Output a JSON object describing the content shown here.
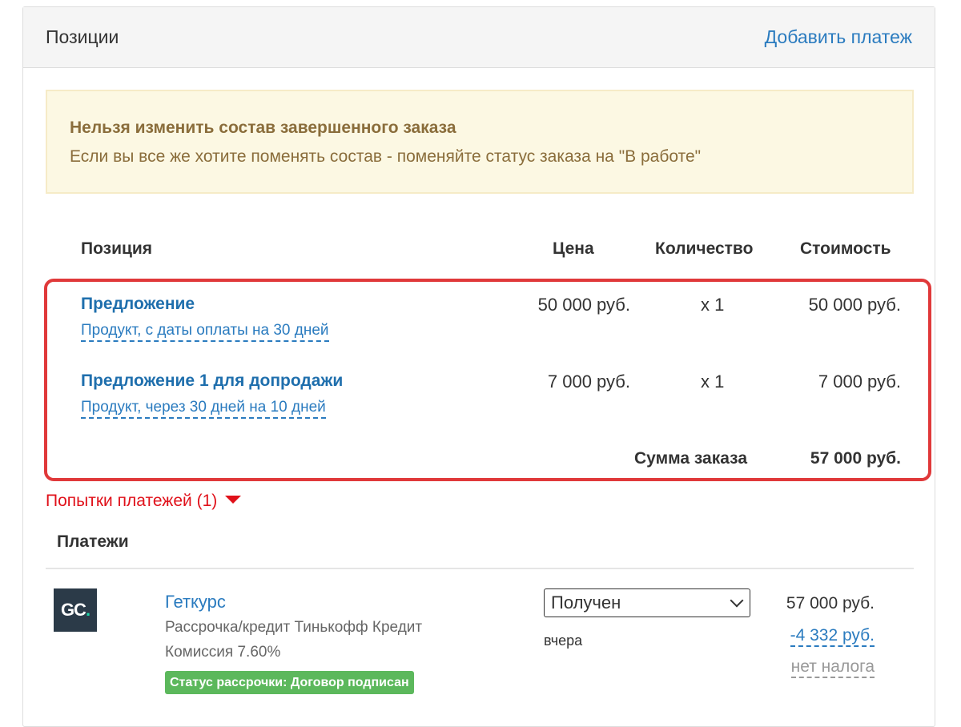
{
  "panel": {
    "title": "Позиции",
    "add_payment_label": "Добавить платеж"
  },
  "alert": {
    "title": "Нельзя изменить состав завершенного заказа",
    "text": "Если вы все же хотите поменять состав - поменяйте статус заказа на \"В работе\""
  },
  "table": {
    "headers": {
      "position": "Позиция",
      "price": "Цена",
      "quantity": "Количество",
      "cost": "Стоимость"
    },
    "rows": [
      {
        "name": "Предложение",
        "subtitle": "Продукт, с даты оплаты на 30 дней",
        "price": "50 000 руб.",
        "quantity": "x 1",
        "cost": "50 000 руб."
      },
      {
        "name": "Предложение 1 для допродажи",
        "subtitle": "Продукт, через 30 дней на 10 дней",
        "price": "7 000 руб.",
        "quantity": "x 1",
        "cost": "7 000 руб."
      }
    ],
    "total_label": "Сумма заказа",
    "total_value": "57 000 руб."
  },
  "attempts": {
    "label": "Попытки платежей (1)"
  },
  "payments": {
    "title": "Платежи",
    "items": [
      {
        "logo_text": "GC",
        "logo_dot": ".",
        "name": "Геткурс",
        "method": "Рассрочка/кредит Тинькофф Кредит",
        "commission": "Комиссия 7.60%",
        "badge": "Статус рассрочки: Договор подписан",
        "status": "Получен",
        "date": "вчера",
        "amount": "57 000 руб.",
        "fee": "-4 332 руб.",
        "tax": "нет налога"
      }
    ]
  },
  "colors": {
    "link": "#2a7bbf",
    "highlight_border": "#e0393a",
    "alert_bg": "#fcf8e3",
    "alert_text": "#8a6d3b",
    "badge_bg": "#5cb85c",
    "attempts": "#e0111a"
  }
}
